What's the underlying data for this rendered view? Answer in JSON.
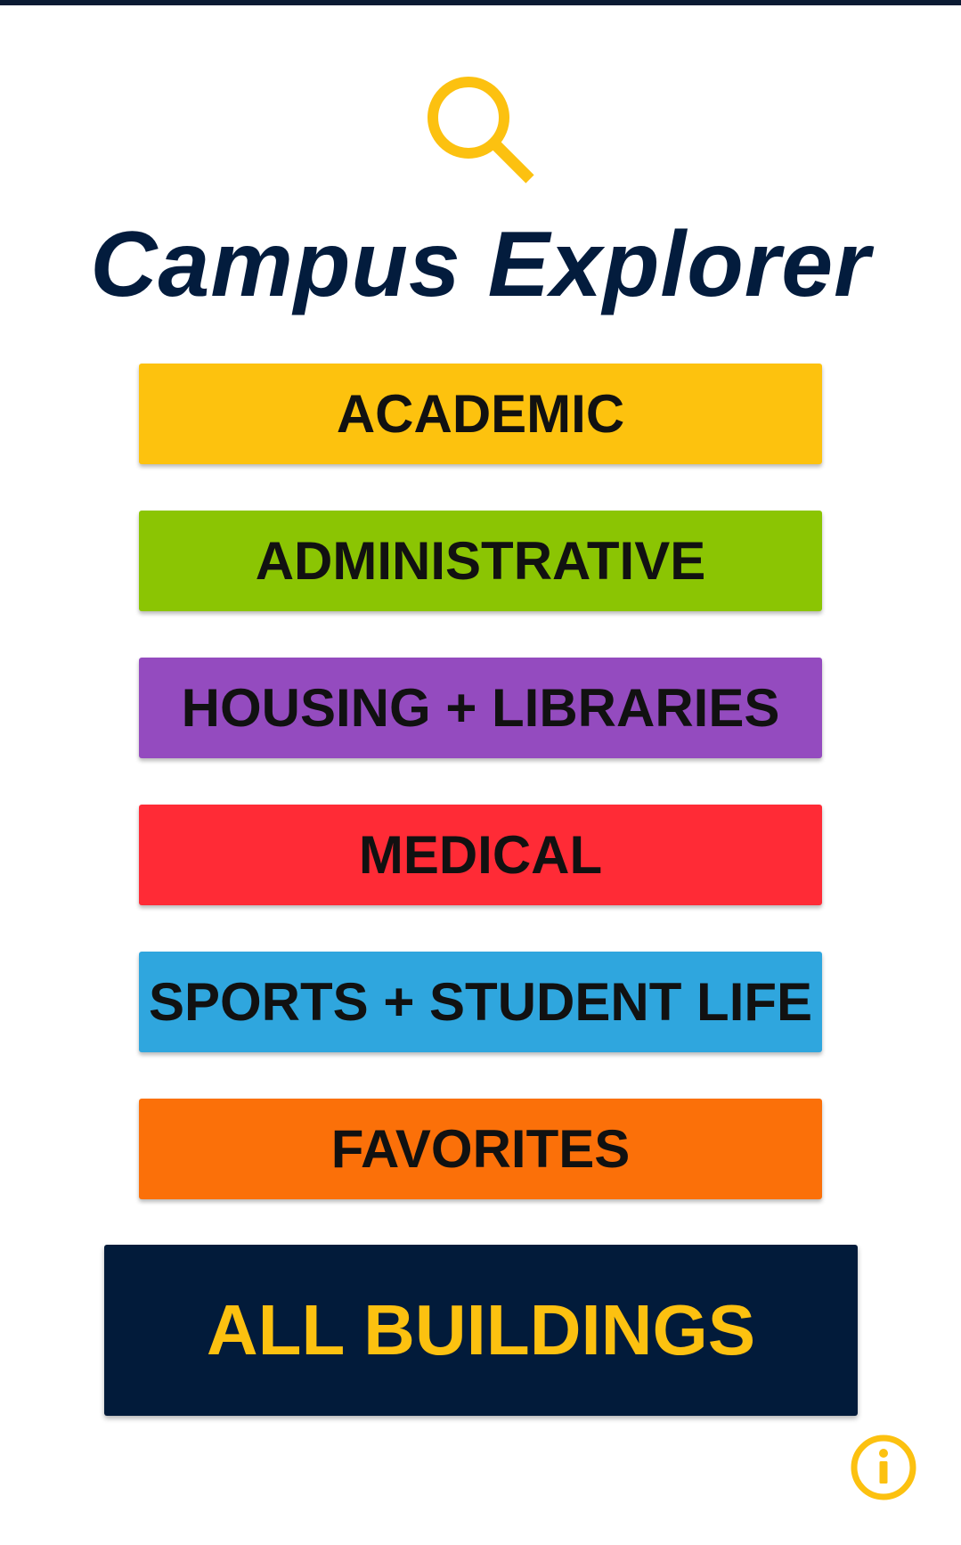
{
  "app": {
    "title": "Campus Explorer"
  },
  "colors": {
    "accent_yellow": "#fcc110",
    "navy": "#021b3a",
    "academic": "#fdc20e",
    "administrative": "#8bc503",
    "housing_libraries": "#944bbf",
    "medical": "#ff2b36",
    "sports_student_life": "#2fa6de",
    "favorites": "#fb7009"
  },
  "icons": {
    "header": "search-icon",
    "info": "info-icon"
  },
  "categories": [
    {
      "label": "ACADEMIC",
      "color": "#fdc20e"
    },
    {
      "label": "ADMINISTRATIVE",
      "color": "#8bc503"
    },
    {
      "label": "HOUSING + LIBRARIES",
      "color": "#944bbf"
    },
    {
      "label": "MEDICAL",
      "color": "#ff2b36"
    },
    {
      "label": "SPORTS + STUDENT LIFE",
      "color": "#2fa6de"
    },
    {
      "label": "FAVORITES",
      "color": "#fb7009"
    }
  ],
  "all_buildings": {
    "label": "ALL BUILDINGS"
  }
}
